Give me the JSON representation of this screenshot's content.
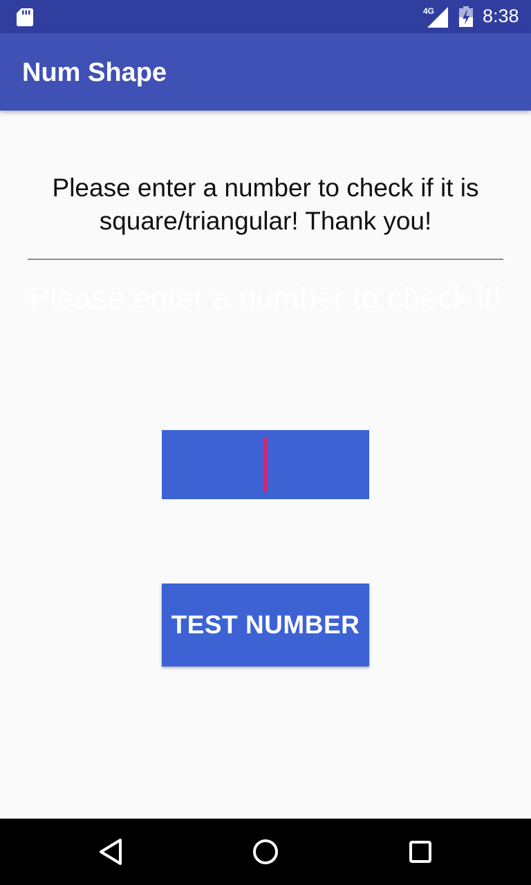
{
  "status_bar": {
    "network_label": "4G",
    "time": "8:38",
    "icons": [
      "sd-card-icon",
      "signal-icon",
      "battery-icon"
    ]
  },
  "app_bar": {
    "title": "Num Shape",
    "color": "#3F51B5"
  },
  "main": {
    "prompt": "Please enter a number to check if it is square/triangular! Thank you!",
    "result_hint": "Please enter a number to check it!",
    "number_input": {
      "value": "",
      "placeholder": ""
    },
    "test_button_label": "TEST NUMBER",
    "accent_color": "#3C62D4",
    "cursor_color": "#E91E63"
  },
  "nav_bar": {
    "icons": [
      "back-icon",
      "home-icon",
      "recent-apps-icon"
    ]
  }
}
